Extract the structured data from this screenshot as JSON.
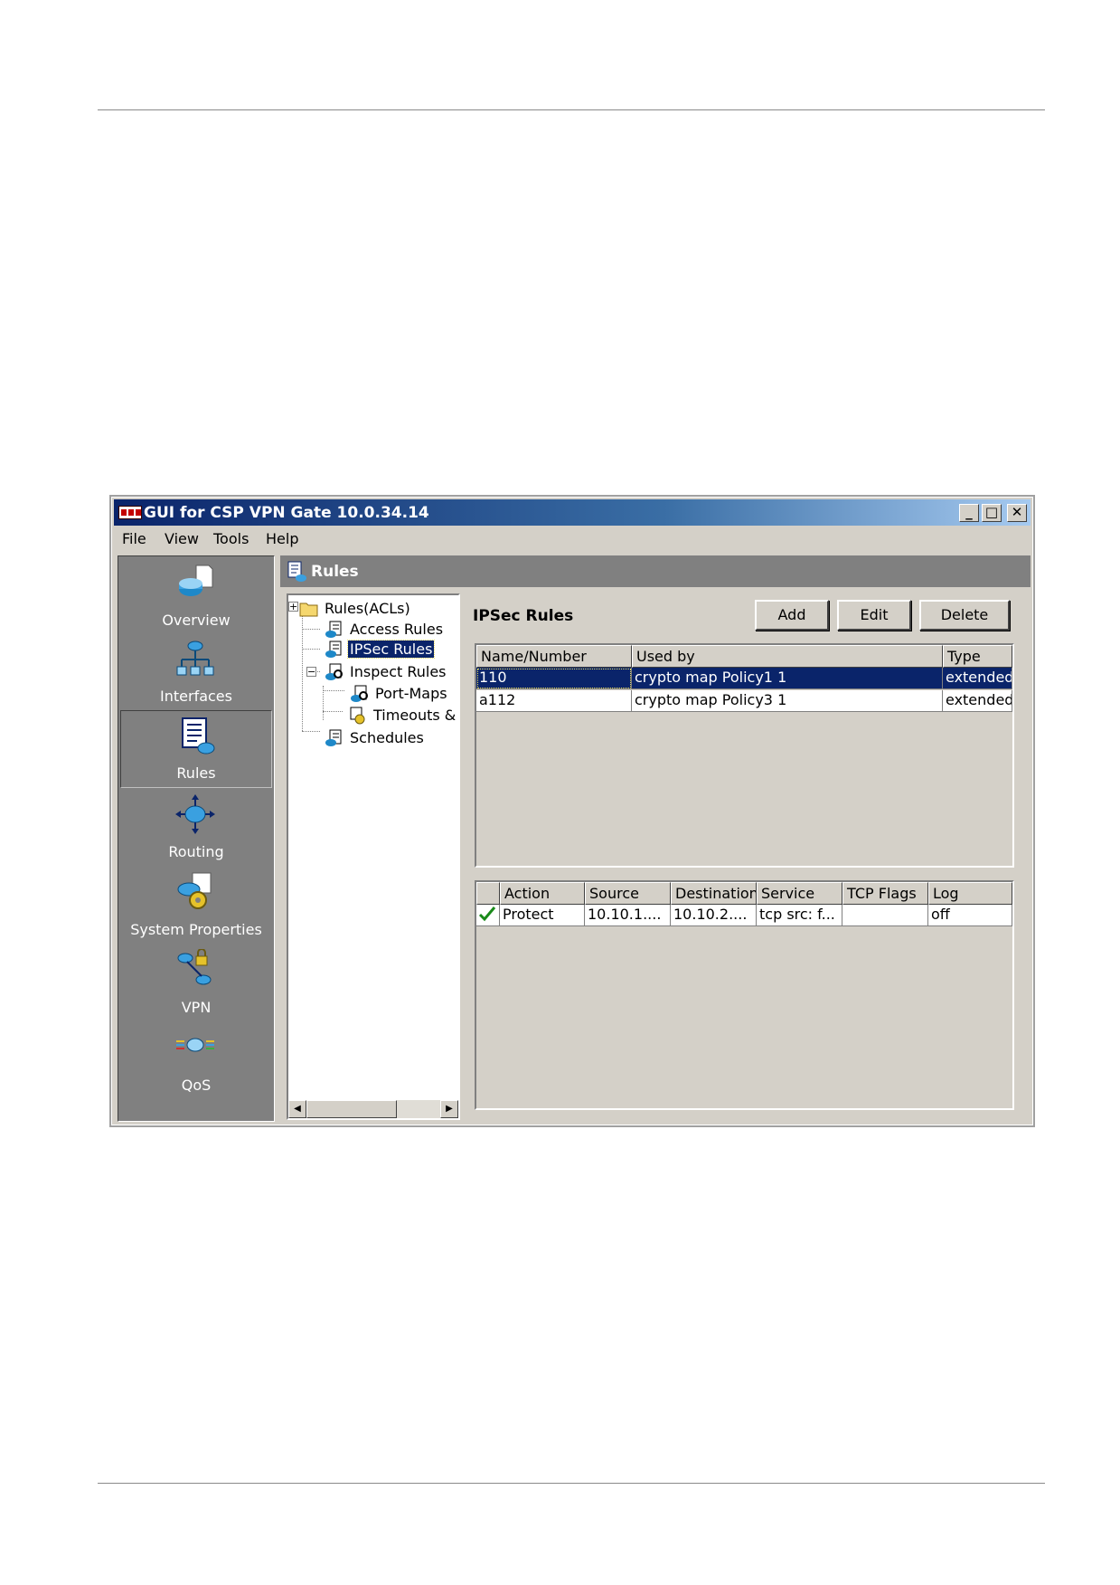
{
  "window": {
    "title": "GUI for CSP VPN Gate 10.0.34.14",
    "minimize_icon": "minimize-icon",
    "maximize_icon": "maximize-icon",
    "close_icon": "close-icon"
  },
  "menu": [
    "File",
    "View",
    "Tools",
    "Help"
  ],
  "sidebar": {
    "items": [
      {
        "label": "Overview",
        "icon": "overview-icon"
      },
      {
        "label": "Interfaces",
        "icon": "interfaces-icon"
      },
      {
        "label": "Rules",
        "icon": "rules-icon",
        "selected": true
      },
      {
        "label": "Routing",
        "icon": "routing-icon"
      },
      {
        "label": "System Properties",
        "icon": "system-properties-icon"
      },
      {
        "label": "VPN",
        "icon": "vpn-icon"
      },
      {
        "label": "QoS",
        "icon": "qos-icon"
      }
    ]
  },
  "content": {
    "header": "Rules",
    "header_icon": "rules-icon"
  },
  "tree": {
    "items": [
      {
        "label": "Rules(ACLs)",
        "icon": "folder-icon"
      },
      {
        "label": "Access Rules",
        "icon": "rule-list-icon"
      },
      {
        "label": "IPSec Rules",
        "icon": "rule-list-icon",
        "selected": true
      },
      {
        "label": "Inspect Rules",
        "icon": "inspect-rules-icon"
      },
      {
        "label": "Port-Maps",
        "icon": "port-maps-icon"
      },
      {
        "label": "Timeouts &",
        "icon": "timeouts-icon"
      },
      {
        "label": "Schedules",
        "icon": "schedules-icon"
      }
    ]
  },
  "ipsec": {
    "title": "IPSec Rules",
    "buttons": {
      "add": "Add",
      "edit": "Edit",
      "delete": "Delete"
    },
    "acl_table": {
      "columns": [
        "Name/Number",
        "Used by",
        "Type"
      ],
      "rows": [
        {
          "name": "110",
          "used_by": "crypto map Policy1 1",
          "type": "extended",
          "selected": true
        },
        {
          "name": "a112",
          "used_by": "crypto map Policy3 1",
          "type": "extended"
        }
      ]
    },
    "rule_table": {
      "columns": [
        "",
        "Action",
        "Source",
        "Destination",
        "Service",
        "TCP Flags",
        "Log"
      ],
      "rows": [
        {
          "enabled": true,
          "action": "Protect",
          "source": "10.10.1....",
          "destination": "10.10.2....",
          "service": "tcp src: f...",
          "tcp_flags": "",
          "log": "off"
        }
      ]
    }
  },
  "colors": {
    "titlebar_start": "#0a246a",
    "titlebar_end": "#a6caf0",
    "selection": "#0a246a",
    "panel_grey": "#808080",
    "face": "#d4d0c8"
  }
}
